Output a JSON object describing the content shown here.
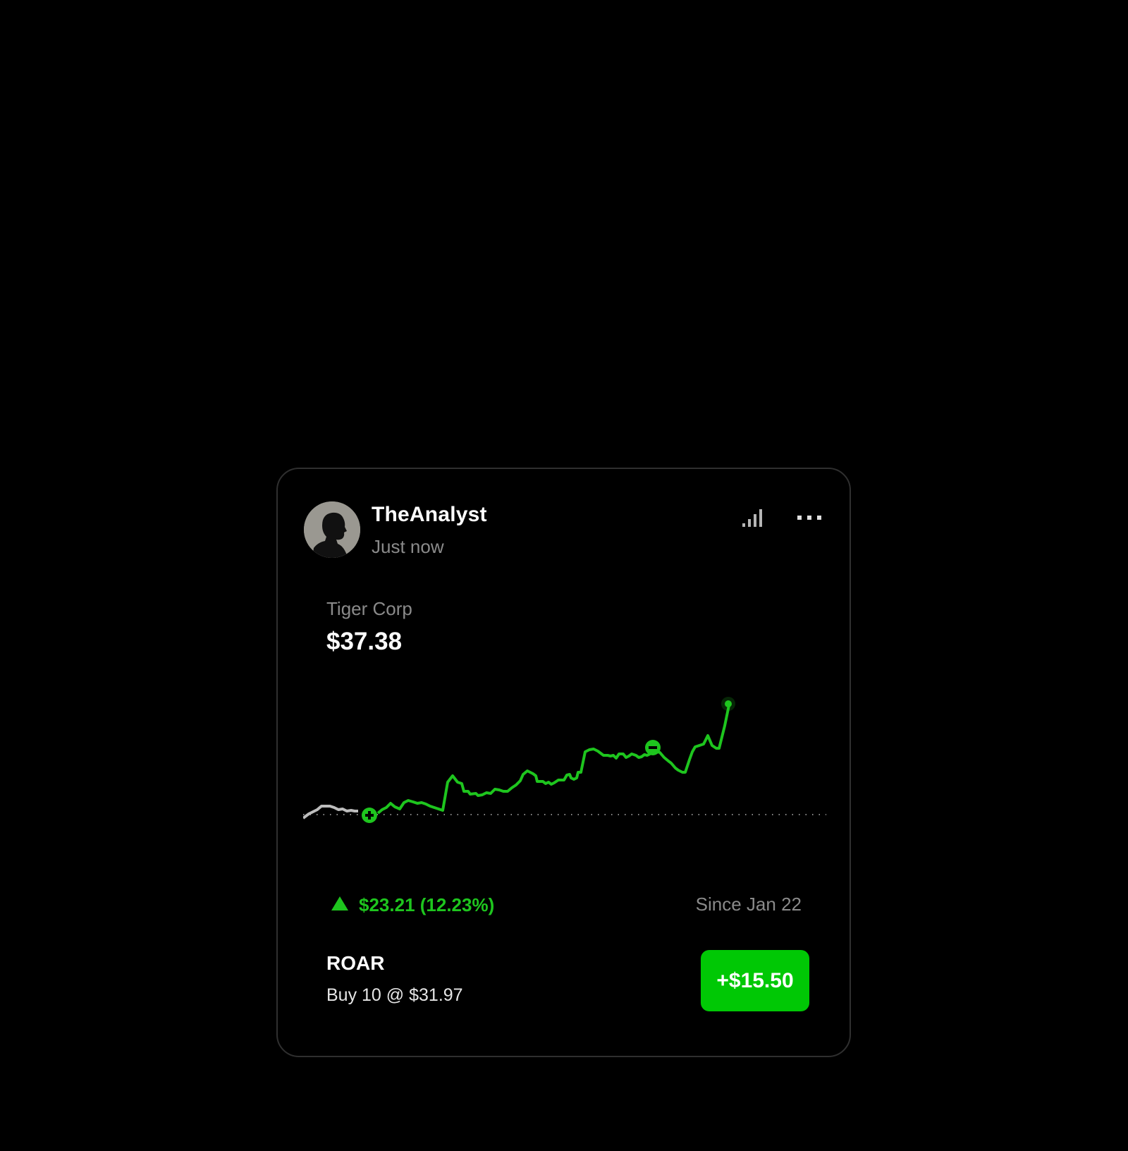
{
  "post": {
    "author": "TheAnalyst",
    "timestamp": "Just now",
    "avatar_icon": "user-silhouette-avatar"
  },
  "header_actions": {
    "signal_icon": "signal-bars-icon",
    "more_icon": "more-dots-icon"
  },
  "stock": {
    "company": "Tiger Corp",
    "price": "$37.38",
    "change": "$23.21 (12.23%)",
    "since": "Since Jan 22",
    "direction_icon": "up-triangle-icon"
  },
  "trade": {
    "ticker": "ROAR",
    "order": "Buy 10 @ $31.97",
    "gain": "+$15.50"
  },
  "colors": {
    "positive": "#00C805",
    "line_pre_entry": "#BDBDBD",
    "muted_text": "#8A8A8A",
    "card_border": "#2F2F2F",
    "background": "#000000"
  },
  "chart_data": {
    "type": "line",
    "baseline": "dotted",
    "markers": [
      {
        "type": "buy",
        "icon": "plus-circle-icon"
      },
      {
        "type": "sell",
        "icon": "minus-circle-icon"
      },
      {
        "type": "current",
        "icon": "current-price-dot"
      }
    ]
  }
}
